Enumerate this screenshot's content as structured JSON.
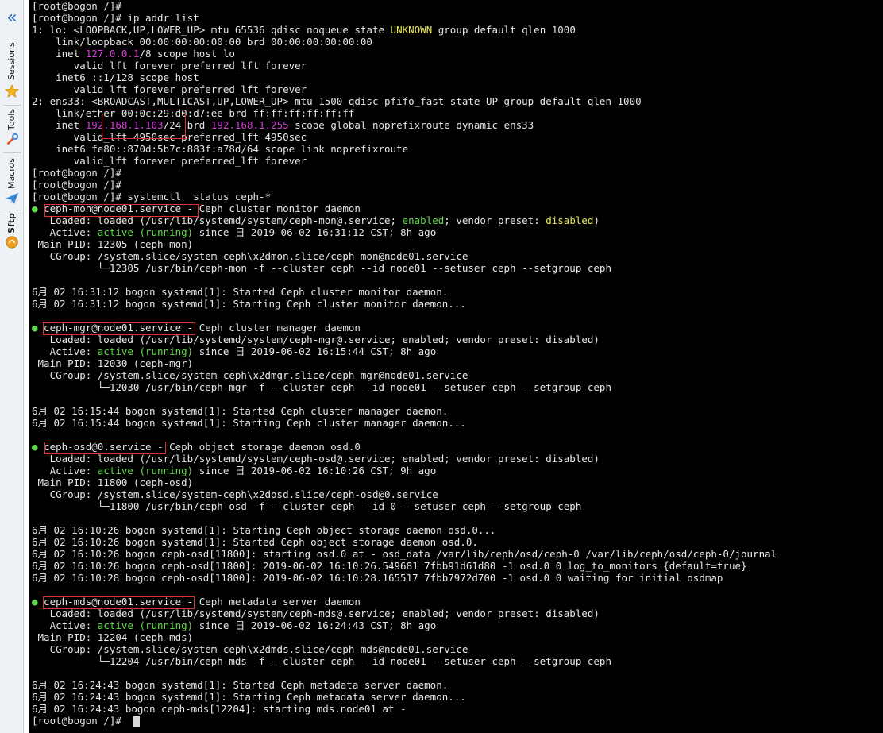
{
  "sidebar": {
    "collapse_glyph": "«",
    "tabs": [
      {
        "label": "Sessions",
        "icon": "star-icon",
        "icon_color": "#f3b51c"
      },
      {
        "label": "Tools",
        "icon": "tools-icon",
        "icon_color": "#e0531f"
      },
      {
        "label": "Macros",
        "icon": "paper-plane-icon",
        "icon_color": "#3b8ad9"
      },
      {
        "label": "Sftp",
        "icon": "sftp-icon",
        "icon_color": "#f0a020"
      }
    ]
  },
  "terminal": {
    "colors": {
      "background": "#000000",
      "foreground": "#e6e6e6",
      "magenta": "#d63ad6",
      "yellow": "#e8e85a",
      "green": "#62d94a",
      "highlight_box": "#e03030"
    },
    "lines": [
      [
        {
          "t": "[root@bogon /]#"
        }
      ],
      [
        {
          "t": "[root@bogon /]# ip addr list"
        }
      ],
      [
        {
          "t": "1: lo: <LOOPBACK,UP,LOWER_UP> mtu 65536 qdisc noqueue state "
        },
        {
          "t": "UNKNOWN",
          "c": "yellow"
        },
        {
          "t": " group default qlen 1000"
        }
      ],
      [
        {
          "t": "    link/loopback 00:00:00:00:00:00 brd 00:00:00:00:00:00"
        }
      ],
      [
        {
          "t": "    inet "
        },
        {
          "t": "127.0.0.1",
          "c": "magenta"
        },
        {
          "t": "/8 scope host lo"
        }
      ],
      [
        {
          "t": "       valid_lft forever preferred_lft forever"
        }
      ],
      [
        {
          "t": "    inet6 ::1/128 scope host"
        }
      ],
      [
        {
          "t": "       valid_lft forever preferred_lft forever"
        }
      ],
      [
        {
          "t": "2: ens33: <BROADCAST,MULTICAST,UP,LOWER_UP> mtu 1500 qdisc pfifo_fast state UP group default qlen 1000"
        }
      ],
      [
        {
          "t": "    link/ether 00:0c:29:d0:d7:ee brd ff:ff:ff:ff:ff:ff"
        }
      ],
      [
        {
          "t": "    inet "
        },
        {
          "t": "192.168.1.103",
          "c": "magenta"
        },
        {
          "t": "/24 brd "
        },
        {
          "t": "192.168.1.255",
          "c": "magenta"
        },
        {
          "t": " scope global noprefixroute dynamic ens33"
        }
      ],
      [
        {
          "t": "       valid_lft 4950sec preferred_lft 4950sec"
        }
      ],
      [
        {
          "t": "    inet6 fe80::870d:5b7c:883f:a78d/64 scope link noprefixroute"
        }
      ],
      [
        {
          "t": "       valid_lft forever preferred_lft forever"
        }
      ],
      [
        {
          "t": "[root@bogon /]#"
        }
      ],
      [
        {
          "t": "[root@bogon /]#"
        }
      ],
      [
        {
          "t": "[root@bogon /]# systemctl  status ceph-*"
        }
      ],
      [
        {
          "t": "●",
          "c": "dot"
        },
        {
          "t": " ceph-mon@node01.service - Ceph cluster monitor daemon"
        }
      ],
      [
        {
          "t": "   Loaded: loaded (/usr/lib/systemd/system/ceph-mon@.service; "
        },
        {
          "t": "enabled",
          "c": "green"
        },
        {
          "t": "; vendor preset: "
        },
        {
          "t": "disabled",
          "c": "yellow"
        },
        {
          "t": ")"
        }
      ],
      [
        {
          "t": "   Active: "
        },
        {
          "t": "active (running)",
          "c": "green"
        },
        {
          "t": " since 日 2019-06-02 16:31:12 CST; 8h ago"
        }
      ],
      [
        {
          "t": " Main PID: 12305 (ceph-mon)"
        }
      ],
      [
        {
          "t": "   CGroup: /system.slice/system-ceph\\x2dmon.slice/ceph-mon@node01.service"
        }
      ],
      [
        {
          "t": "           └─12305 /usr/bin/ceph-mon -f --cluster ceph --id node01 --setuser ceph --setgroup ceph"
        }
      ],
      [
        {
          "t": ""
        }
      ],
      [
        {
          "t": "6月 02 16:31:12 bogon systemd[1]: Started Ceph cluster monitor daemon."
        }
      ],
      [
        {
          "t": "6月 02 16:31:12 bogon systemd[1]: Starting Ceph cluster monitor daemon..."
        }
      ],
      [
        {
          "t": ""
        }
      ],
      [
        {
          "t": "●",
          "c": "dot"
        },
        {
          "t": " ceph-mgr@node01.service - Ceph cluster manager daemon"
        }
      ],
      [
        {
          "t": "   Loaded: loaded (/usr/lib/systemd/system/ceph-mgr@.service; enabled; vendor preset: disabled)"
        }
      ],
      [
        {
          "t": "   Active: "
        },
        {
          "t": "active (running)",
          "c": "green"
        },
        {
          "t": " since 日 2019-06-02 16:15:44 CST; 8h ago"
        }
      ],
      [
        {
          "t": " Main PID: 12030 (ceph-mgr)"
        }
      ],
      [
        {
          "t": "   CGroup: /system.slice/system-ceph\\x2dmgr.slice/ceph-mgr@node01.service"
        }
      ],
      [
        {
          "t": "           └─12030 /usr/bin/ceph-mgr -f --cluster ceph --id node01 --setuser ceph --setgroup ceph"
        }
      ],
      [
        {
          "t": ""
        }
      ],
      [
        {
          "t": "6月 02 16:15:44 bogon systemd[1]: Started Ceph cluster manager daemon."
        }
      ],
      [
        {
          "t": "6月 02 16:15:44 bogon systemd[1]: Starting Ceph cluster manager daemon..."
        }
      ],
      [
        {
          "t": ""
        }
      ],
      [
        {
          "t": "●",
          "c": "dot"
        },
        {
          "t": " ceph-osd@0.service - Ceph object storage daemon osd.0"
        }
      ],
      [
        {
          "t": "   Loaded: loaded (/usr/lib/systemd/system/ceph-osd@.service; enabled; vendor preset: disabled)"
        }
      ],
      [
        {
          "t": "   Active: "
        },
        {
          "t": "active (running)",
          "c": "green"
        },
        {
          "t": " since 日 2019-06-02 16:10:26 CST; 9h ago"
        }
      ],
      [
        {
          "t": " Main PID: 11800 (ceph-osd)"
        }
      ],
      [
        {
          "t": "   CGroup: /system.slice/system-ceph\\x2dosd.slice/ceph-osd@0.service"
        }
      ],
      [
        {
          "t": "           └─11800 /usr/bin/ceph-osd -f --cluster ceph --id 0 --setuser ceph --setgroup ceph"
        }
      ],
      [
        {
          "t": ""
        }
      ],
      [
        {
          "t": "6月 02 16:10:26 bogon systemd[1]: Starting Ceph object storage daemon osd.0..."
        }
      ],
      [
        {
          "t": "6月 02 16:10:26 bogon systemd[1]: Started Ceph object storage daemon osd.0."
        }
      ],
      [
        {
          "t": "6月 02 16:10:26 bogon ceph-osd[11800]: starting osd.0 at - osd_data /var/lib/ceph/osd/ceph-0 /var/lib/ceph/osd/ceph-0/journal"
        }
      ],
      [
        {
          "t": "6月 02 16:10:26 bogon ceph-osd[11800]: 2019-06-02 16:10:26.549681 7fbb91d61d80 -1 osd.0 0 log_to_monitors {default=true}"
        }
      ],
      [
        {
          "t": "6月 02 16:10:28 bogon ceph-osd[11800]: 2019-06-02 16:10:28.165517 7fbb7972d700 -1 osd.0 0 waiting for initial osdmap"
        }
      ],
      [
        {
          "t": ""
        }
      ],
      [
        {
          "t": "●",
          "c": "dot"
        },
        {
          "t": " ceph-mds@node01.service - Ceph metadata server daemon"
        }
      ],
      [
        {
          "t": "   Loaded: loaded (/usr/lib/systemd/system/ceph-mds@.service; enabled; vendor preset: disabled)"
        }
      ],
      [
        {
          "t": "   Active: "
        },
        {
          "t": "active (running)",
          "c": "green"
        },
        {
          "t": " since 日 2019-06-02 16:24:43 CST; 8h ago"
        }
      ],
      [
        {
          "t": " Main PID: 12204 (ceph-mds)"
        }
      ],
      [
        {
          "t": "   CGroup: /system.slice/system-ceph\\x2dmds.slice/ceph-mds@node01.service"
        }
      ],
      [
        {
          "t": "           └─12204 /usr/bin/ceph-mds -f --cluster ceph --id node01 --setuser ceph --setgroup ceph"
        }
      ],
      [
        {
          "t": ""
        }
      ],
      [
        {
          "t": "6月 02 16:24:43 bogon systemd[1]: Started Ceph metadata server daemon."
        }
      ],
      [
        {
          "t": "6月 02 16:24:43 bogon systemd[1]: Starting Ceph metadata server daemon..."
        }
      ],
      [
        {
          "t": "6月 02 16:24:43 bogon ceph-mds[12204]: starting mds.node01 at -"
        }
      ],
      [
        {
          "t": "[root@bogon /]# "
        }
      ]
    ]
  }
}
